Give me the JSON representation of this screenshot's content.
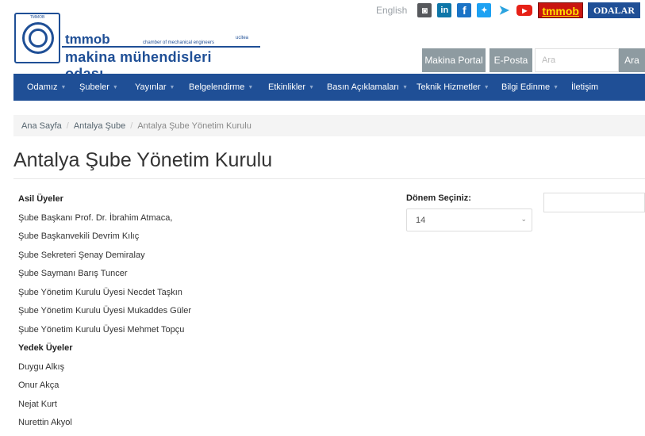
{
  "header": {
    "logo": {
      "seal_caption": "TMMOB",
      "tmmob": "tmmob",
      "ucte": "ucitea",
      "cme": "chamber of mechanical engineers",
      "mmo": "makina mühendisleri odası"
    },
    "english_label": "English",
    "social": [
      {
        "name": "instagram-icon",
        "glyph": "◙"
      },
      {
        "name": "linkedin-icon",
        "glyph": "in"
      },
      {
        "name": "facebook-icon",
        "glyph": "f"
      },
      {
        "name": "twitter-icon",
        "glyph": "✦"
      },
      {
        "name": "telegram-icon",
        "glyph": "➤"
      },
      {
        "name": "youtube-icon",
        "glyph": "▶"
      }
    ],
    "tmmob_badge": "tmmob",
    "odalar_label": "ODALAR",
    "portal_label": "Makina Portal",
    "eposta_label": "E-Posta",
    "search_placeholder": "Ara",
    "search_button": "Ara"
  },
  "nav": {
    "items": [
      {
        "label": "Odamız",
        "caret": true
      },
      {
        "label": "Şubeler",
        "caret": true
      },
      {
        "label": "Yayınlar",
        "caret": true
      },
      {
        "label": "Belgelendirme",
        "caret": true
      },
      {
        "label": "Etkinlikler",
        "caret": true
      },
      {
        "label": "Basın Açıklamaları",
        "caret": true
      },
      {
        "label": "Teknik Hizmetler",
        "caret": true
      },
      {
        "label": "Bilgi Edinme",
        "caret": true
      },
      {
        "label": "İletişim",
        "caret": false
      }
    ]
  },
  "breadcrumb": {
    "home": "Ana Sayfa",
    "branch": "Antalya Şube",
    "current": "Antalya Şube Yönetim Kurulu"
  },
  "page": {
    "title": "Antalya Şube Yönetim Kurulu"
  },
  "members": {
    "rows": [
      {
        "text": "Asil Üyeler",
        "heading": true
      },
      {
        "text": "Şube Başkanı Prof. Dr. İbrahim Atmaca,",
        "heading": false
      },
      {
        "text": "Şube Başkanvekili Devrim Kılıç",
        "heading": false
      },
      {
        "text": "Şube Sekreteri Şenay Demiralay",
        "heading": false
      },
      {
        "text": "Şube Saymanı Barış Tuncer",
        "heading": false
      },
      {
        "text": "Şube Yönetim Kurulu Üyesi Necdet Taşkın",
        "heading": false
      },
      {
        "text": "Şube Yönetim Kurulu Üyesi Mukaddes Güler",
        "heading": false
      },
      {
        "text": "Şube Yönetim Kurulu Üyesi Mehmet Topçu",
        "heading": false
      },
      {
        "text": "Yedek Üyeler",
        "heading": true
      },
      {
        "text": "Duygu Alkış",
        "heading": false
      },
      {
        "text": "Onur Akça",
        "heading": false
      },
      {
        "text": "Nejat Kurt",
        "heading": false
      },
      {
        "text": "Nurettin Akyol",
        "heading": false
      }
    ]
  },
  "period": {
    "label": "Dönem Seçiniz:",
    "selected": "14"
  },
  "colors": {
    "brand_blue": "#1f4f96",
    "button_gray": "#8e9ba1",
    "badge_red": "#c9150f",
    "badge_yellow": "#ffe200"
  }
}
